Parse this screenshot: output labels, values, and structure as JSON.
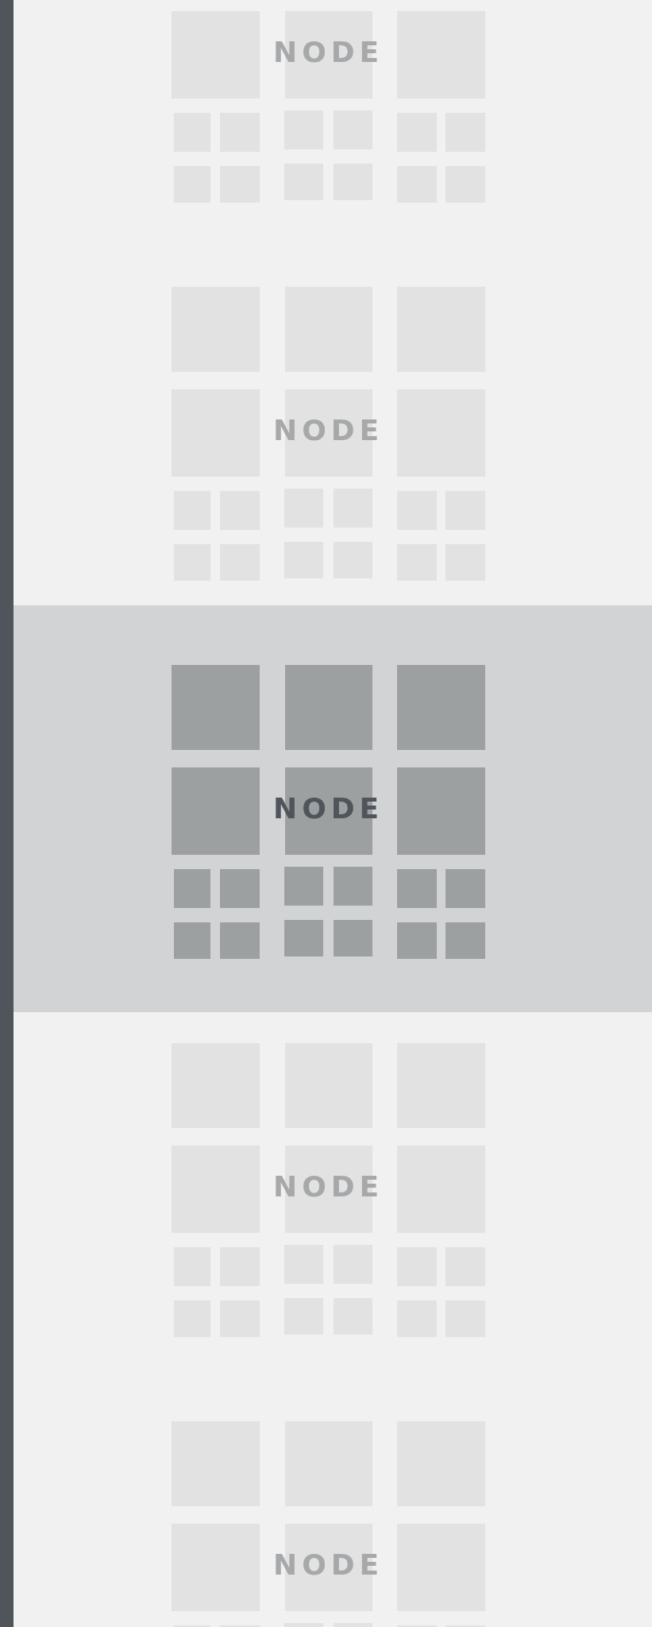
{
  "nodes": [
    {
      "label": "NODE",
      "selected": false
    },
    {
      "label": "NODE",
      "selected": false
    },
    {
      "label": "NODE",
      "selected": true
    },
    {
      "label": "NODE",
      "selected": false
    },
    {
      "label": "NODE",
      "selected": false
    }
  ]
}
